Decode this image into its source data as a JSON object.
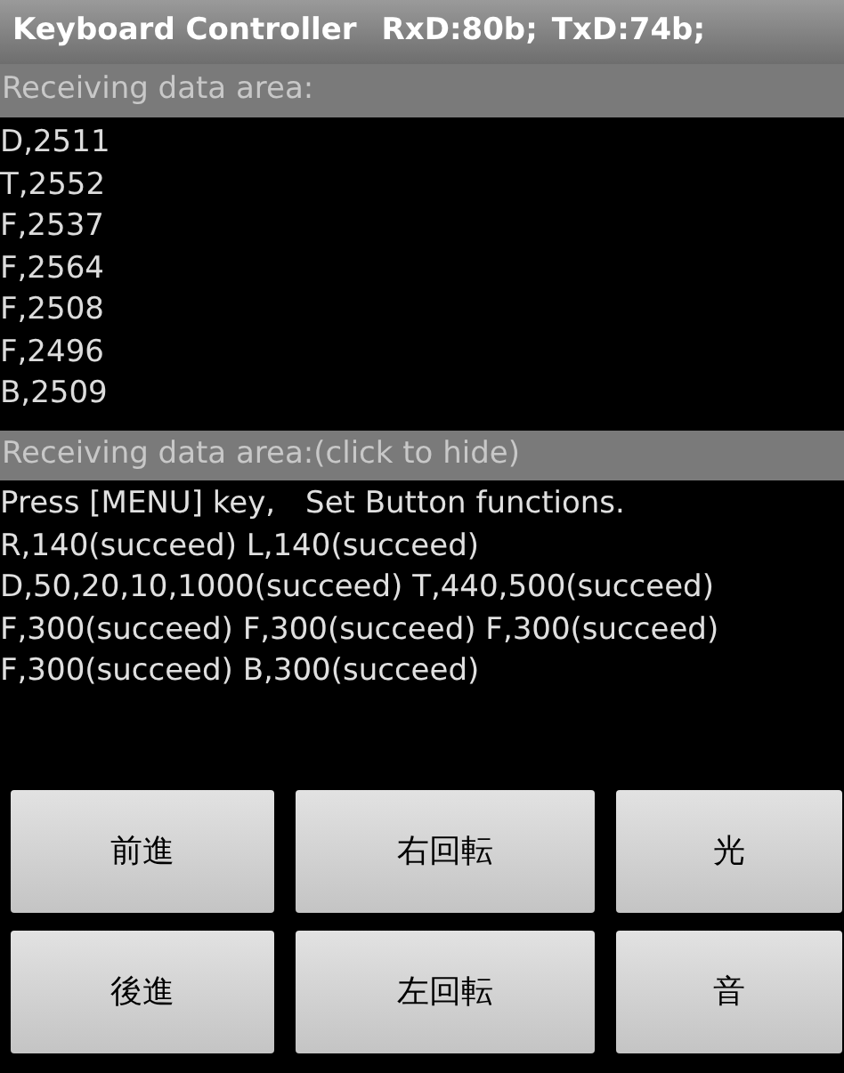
{
  "window": {
    "title": "Keyboard Controller",
    "rxd": "RxD:80b;",
    "txd": "TxD:74b;"
  },
  "receive_header": "Receiving data area:",
  "receive_lines": [
    "D,2511",
    "T,2552",
    "F,2537",
    "F,2564",
    "F,2508",
    "F,2496",
    "B,2509"
  ],
  "log_header": "Receiving data area:(click to hide)",
  "log_lines": [
    "Press [MENU] key,　Set Button functions.",
    "R,140(succeed) L,140(succeed)",
    "D,50,20,10,1000(succeed) T,440,500(succeed)",
    "F,300(succeed) F,300(succeed) F,300(succeed)",
    "F,300(succeed) B,300(succeed)"
  ],
  "buttons": [
    [
      "前進",
      "右回転",
      "光"
    ],
    [
      "後進",
      "左回転",
      "音"
    ]
  ]
}
